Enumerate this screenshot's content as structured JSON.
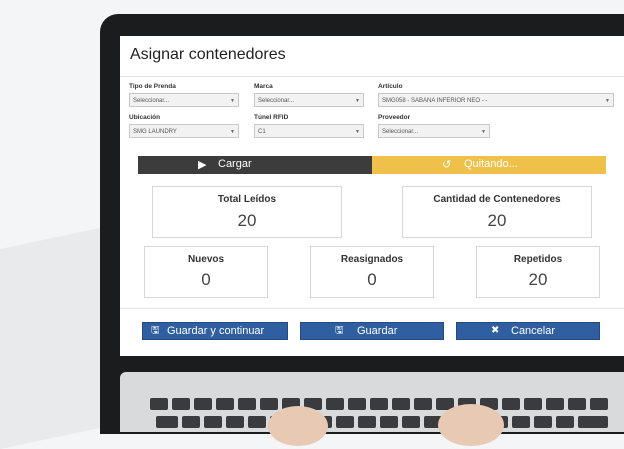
{
  "title": "Asignar contenedores",
  "fields": {
    "tipo_prenda": {
      "label": "Tipo de Prenda",
      "value": "Seleccionar..."
    },
    "marca": {
      "label": "Marca",
      "value": "Seleccionar..."
    },
    "articulo": {
      "label": "Artículo",
      "value": "SMG058 - SABANA INFERIOR NEO - -"
    },
    "ubicacion": {
      "label": "Ubicación",
      "value": "SMG LAUNDRY"
    },
    "tunel": {
      "label": "Túnel RFID",
      "value": "C1"
    },
    "proveedor": {
      "label": "Proveedor",
      "value": "Seleccionar..."
    }
  },
  "actions": {
    "cargar": "Cargar",
    "quitando": "Quitando..."
  },
  "stats": {
    "total_leidos": {
      "label": "Total Leídos",
      "value": "20"
    },
    "cantidad_contenedores": {
      "label": "Cantidad de Contenedores",
      "value": "20"
    },
    "nuevos": {
      "label": "Nuevos",
      "value": "0"
    },
    "reasignados": {
      "label": "Reasignados",
      "value": "0"
    },
    "repetidos": {
      "label": "Repetidos",
      "value": "20"
    }
  },
  "buttons": {
    "guardar_continuar": "Guardar y continuar",
    "guardar": "Guardar",
    "cancelar": "Cancelar"
  },
  "icons": {
    "play": "play-icon",
    "undo": "undo-icon",
    "save": "save-icon",
    "close": "close-icon"
  },
  "colors": {
    "accent_blue": "#2f5fa0",
    "accent_yellow": "#f0c14a",
    "dark_bar": "#3c3c3c"
  }
}
